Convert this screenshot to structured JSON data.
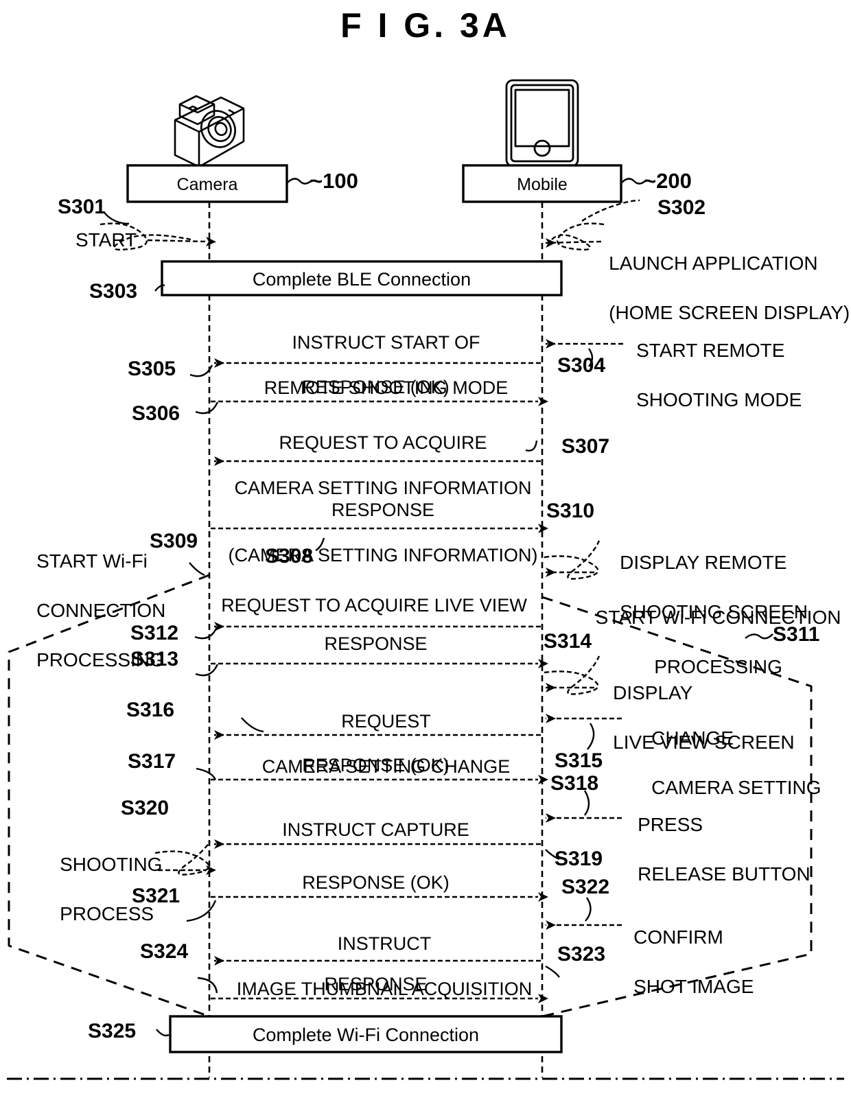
{
  "figure": {
    "title": "F I G.  3A"
  },
  "actors": [
    {
      "label": "Camera",
      "ref": "~100",
      "icon": "camera-icon"
    },
    {
      "label": "Mobile",
      "ref": "~200",
      "icon": "smartphone-icon"
    }
  ],
  "sync_boxes": [
    {
      "id": "S303",
      "id_display": "S303 ~",
      "label": "Complete BLE Connection"
    },
    {
      "id": "S325",
      "id_display": "S325 ~",
      "label": "Complete Wi-Fi Connection"
    }
  ],
  "messages": [
    {
      "id": "S305",
      "text": "INSTRUCT START OF\nREMOTE SHOOTING MODE",
      "direction": "mobile-to-camera"
    },
    {
      "id": "S306",
      "text": "RESPONSE (OK)",
      "direction": "camera-to-mobile"
    },
    {
      "id": "S307",
      "text": "REQUEST TO ACQUIRE\nCAMERA SETTING INFORMATION",
      "direction": "mobile-to-camera"
    },
    {
      "id": "S308",
      "text": "RESPONSE\n(CAMERA SETTING INFORMATION)",
      "direction": "camera-to-mobile"
    },
    {
      "id": "S312",
      "text": "REQUEST TO ACQUIRE LIVE VIEW",
      "direction": "mobile-to-camera"
    },
    {
      "id": "S313",
      "text": "RESPONSE",
      "direction": "camera-to-mobile"
    },
    {
      "id": "S316",
      "text": "REQUEST\nCAMERA SETTING CHANGE",
      "direction": "mobile-to-camera"
    },
    {
      "id": "S317",
      "text": "RESPONSE (OK)",
      "direction": "camera-to-mobile"
    },
    {
      "id": "S320",
      "text": "INSTRUCT CAPTURE",
      "direction": "mobile-to-camera"
    },
    {
      "id": "S321",
      "text": "RESPONSE (OK)",
      "direction": "camera-to-mobile"
    },
    {
      "id": "S323",
      "text": "INSTRUCT\nIMAGE THUMBNAIL ACQUISITION",
      "direction": "mobile-to-camera"
    },
    {
      "id": "S324",
      "text": "RESPONSE",
      "direction": "camera-to-mobile"
    }
  ],
  "annotations": [
    {
      "id": "S301",
      "text": "START",
      "side": "left"
    },
    {
      "id": "S302",
      "text": "LAUNCH APPLICATION\n(HOME SCREEN DISPLAY)",
      "side": "right"
    },
    {
      "id": "S304",
      "text": "START REMOTE\nSHOOTING MODE",
      "side": "right"
    },
    {
      "id": "S309",
      "text": "START Wi-Fi\nCONNECTION\nPROCESSING",
      "side": "left"
    },
    {
      "id": "S310",
      "text": "DISPLAY REMOTE\nSHOOTING SCREEN",
      "side": "right"
    },
    {
      "id": "S311",
      "text": "START Wi-Fi CONNECTION\nPROCESSING",
      "side": "right"
    },
    {
      "id": "S314",
      "text": "DISPLAY\nLIVE VIEW SCREEN",
      "side": "right"
    },
    {
      "id": "S315",
      "text": "CHANGE\nCAMERA SETTING",
      "side": "right"
    },
    {
      "id": "S318",
      "text": "PRESS\nRELEASE BUTTON",
      "side": "right"
    },
    {
      "id": "S319",
      "text": "SHOOTING\nPROCESS",
      "side": "left"
    },
    {
      "id": "S322",
      "text": "CONFIRM\nSHOT IMAGE",
      "side": "right"
    }
  ],
  "step_ids": {
    "s301": "S301",
    "s302": "S302",
    "s303": "S303",
    "s304": "S304",
    "s305": "S305",
    "s306": "S306",
    "s307": "S307",
    "s308": "S308",
    "s309": "S309",
    "s310": "S310",
    "s311": "S311",
    "s312": "S312",
    "s313": "S313",
    "s314": "S314",
    "s315": "S315",
    "s316": "S316",
    "s317": "S317",
    "s318": "S318",
    "s319": "S319",
    "s320": "S320",
    "s321": "S321",
    "s322": "S322",
    "s323": "S323",
    "s324": "S324",
    "s325": "S325"
  },
  "message_texts": {
    "m305_l1": "INSTRUCT START OF",
    "m305_l2": "REMOTE SHOOTING MODE",
    "m306": "RESPONSE (OK)",
    "m307_l1": "REQUEST TO ACQUIRE",
    "m307_l2": "CAMERA SETTING INFORMATION",
    "m308_l1": "RESPONSE",
    "m308_l2": "(CAMERA SETTING INFORMATION)",
    "m312": "REQUEST TO ACQUIRE LIVE VIEW",
    "m313": "RESPONSE",
    "m316_l1": "REQUEST",
    "m316_l2": "CAMERA SETTING CHANGE",
    "m317": "RESPONSE (OK)",
    "m320": "INSTRUCT CAPTURE",
    "m321": "RESPONSE (OK)",
    "m323_l1": "INSTRUCT",
    "m323_l2": "IMAGE THUMBNAIL ACQUISITION",
    "m324": "RESPONSE"
  },
  "annotation_texts": {
    "a301": "START",
    "a302_l1": "LAUNCH APPLICATION",
    "a302_l2": "(HOME SCREEN DISPLAY)",
    "a304_l1": "START REMOTE",
    "a304_l2": "SHOOTING MODE",
    "a309_l1": "START Wi-Fi",
    "a309_l2": "CONNECTION",
    "a309_l3": "PROCESSING",
    "a310_l1": "DISPLAY REMOTE",
    "a310_l2": "SHOOTING SCREEN",
    "a311_l1": "START Wi-Fi CONNECTION",
    "a311_l2": "PROCESSING",
    "a314_l1": "DISPLAY",
    "a314_l2": "LIVE VIEW SCREEN",
    "a315_l1": "CHANGE",
    "a315_l2": "CAMERA SETTING",
    "a318_l1": "PRESS",
    "a318_l2": "RELEASE BUTTON",
    "a319_l1": "SHOOTING",
    "a319_l2": "PROCESS",
    "a322_l1": "CONFIRM",
    "a322_l2": "SHOT IMAGE"
  },
  "box_texts": {
    "ble": "Complete BLE Connection",
    "wifi": "Complete Wi-Fi Connection"
  },
  "actor_texts": {
    "camera": "Camera",
    "mobile": "Mobile",
    "camera_ref": "~100",
    "mobile_ref": "~200"
  },
  "colors": {
    "ink": "#000000",
    "paper": "#ffffff"
  }
}
